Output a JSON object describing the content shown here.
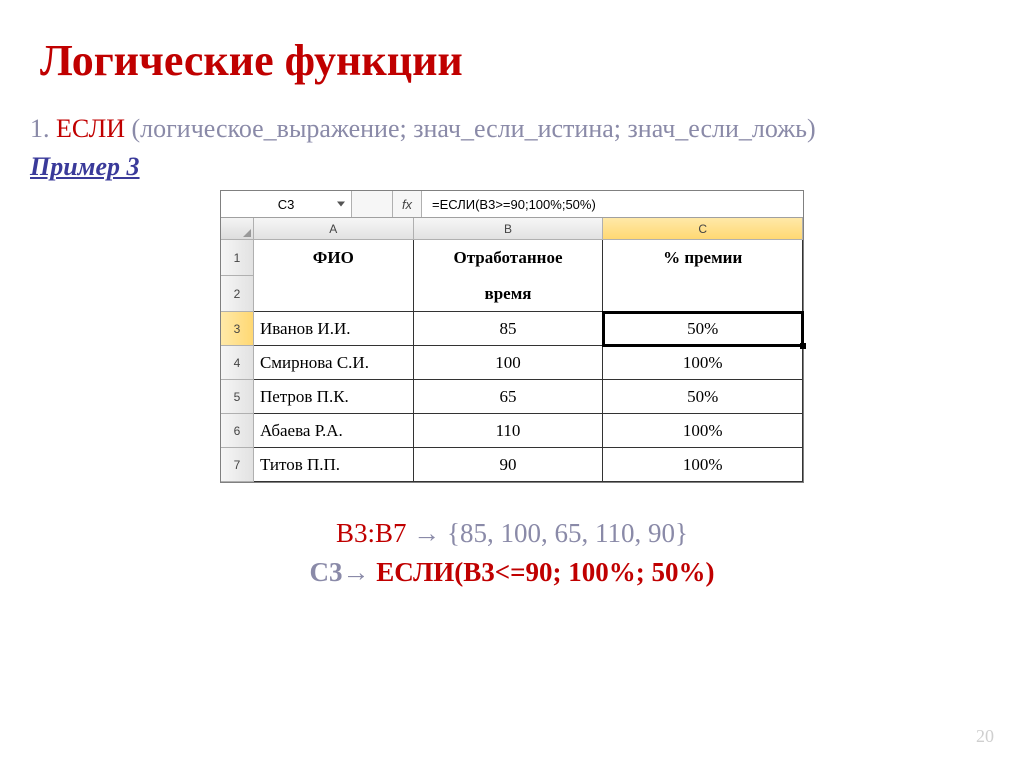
{
  "title": "Логические функции",
  "description": {
    "num": "1.",
    "fn": "ЕСЛИ",
    "args": "(логическое_выражение; знач_если_истина; знач_если_ложь)"
  },
  "example_label": "Пример 3",
  "excel": {
    "namebox": "C3",
    "fx_symbol": "fx",
    "formula": "=ЕСЛИ(B3>=90;100%;50%)",
    "columns": [
      "A",
      "B",
      "C"
    ],
    "headers": {
      "a": "ФИО",
      "b": "Отработанное время",
      "c": "% премии"
    },
    "rows": [
      {
        "r": "3",
        "a": "Иванов И.И.",
        "b": "85",
        "c": "50%"
      },
      {
        "r": "4",
        "a": "Смирнова С.И.",
        "b": "100",
        "c": "100%"
      },
      {
        "r": "5",
        "a": "Петров П.К.",
        "b": "65",
        "c": "50%"
      },
      {
        "r": "6",
        "a": "Абаева Р.А.",
        "b": "110",
        "c": "100%"
      },
      {
        "r": "7",
        "a": "Титов П.П.",
        "b": "90",
        "c": "100%"
      }
    ],
    "row_head_1": "1",
    "row_head_2": "2"
  },
  "bottom": {
    "line1_range": "B3:B7",
    "line1_arrow": "→",
    "line1_values": "{85, 100, 65, 110, 90}",
    "line2_cref": "C3",
    "line2_arrow": "→",
    "line2_formula": "ЕСЛИ(B3<=90; 100%; 50%)"
  },
  "page_number": "20"
}
